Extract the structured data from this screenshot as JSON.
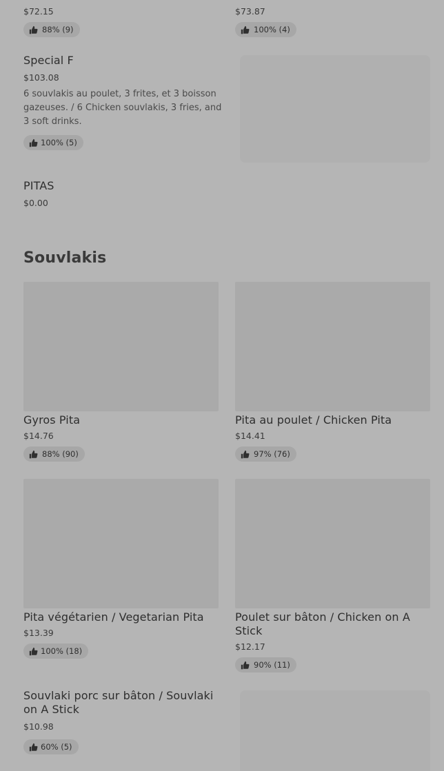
{
  "top_row": [
    {
      "price": "$72.15",
      "rating": "88% (9)"
    },
    {
      "price": "$73.87",
      "rating": "100% (4)"
    }
  ],
  "special_f": {
    "name": "Special F",
    "price": "$103.08",
    "description": "6 souvlakis au poulet, 3 frites, et 3 boisson gazeuses. / 6 Chicken souvlakis, 3 fries, and 3 soft drinks.",
    "rating": "100% (5)"
  },
  "pitas": {
    "name": "PITAS",
    "price": "$0.00"
  },
  "section": {
    "title": "Souvlakis"
  },
  "items": [
    {
      "name": "Gyros Pita",
      "price": "$14.76",
      "rating": "88% (90)"
    },
    {
      "name": "Pita au poulet / Chicken Pita",
      "price": "$14.41",
      "rating": "97% (76)"
    },
    {
      "name": "Pita végétarien / Vegetarian Pita",
      "price": "$13.39",
      "rating": "100% (18)"
    },
    {
      "name": "Poulet sur bâton / Chicken on A Stick",
      "price": "$12.17",
      "rating": "90% (11)"
    },
    {
      "name": "Souvlaki porc sur bâton / Souvlaki on A Stick",
      "price": "$10.98",
      "rating": "60% (5)"
    }
  ],
  "icons": {
    "rating": "thumbs-up-icon"
  }
}
